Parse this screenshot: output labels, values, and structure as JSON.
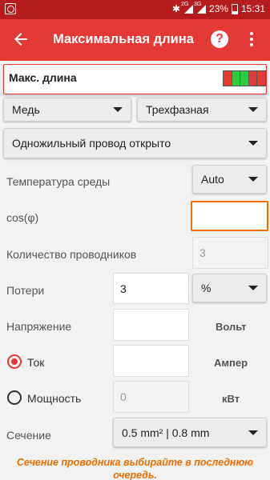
{
  "status_bar": {
    "net1": "2G",
    "net2": "3G",
    "battery": "23%",
    "time": "15:31"
  },
  "app_bar": {
    "title": "Максимальная длина",
    "help_symbol": "?"
  },
  "header": {
    "label": "Макс. длина",
    "indicator_colors": [
      "#e53935",
      "#2ecc40",
      "#2ecc40",
      "#e53935",
      "#e53935"
    ]
  },
  "material_select": {
    "value": "Медь"
  },
  "phase_select": {
    "value": "Трехфазная"
  },
  "cable_select": {
    "value": "Одножильный провод открыто"
  },
  "temperature": {
    "label": "Температура среды",
    "value": "Auto"
  },
  "cos_phi": {
    "label": "cos(φ)",
    "value": ""
  },
  "conductors": {
    "label": "Количество проводников",
    "value": "3"
  },
  "losses": {
    "label": "Потери",
    "value": "3",
    "unit_value": "%"
  },
  "voltage": {
    "label": "Напряжение",
    "value": "",
    "unit": "Вольт"
  },
  "current": {
    "label": "Ток",
    "value": "",
    "unit": "Ампер",
    "selected": true
  },
  "power": {
    "label": "Мощность",
    "value": "0",
    "unit": "кВт",
    "selected": false
  },
  "section": {
    "label": "Сечение",
    "value": "0.5 mm² | 0.8 mm"
  },
  "note": "Сечение проводника выбирайте в последнюю очередь.",
  "colors": {
    "status_bar": "#b71c1c",
    "app_bar": "#e53935",
    "accent": "#ef6c00"
  }
}
